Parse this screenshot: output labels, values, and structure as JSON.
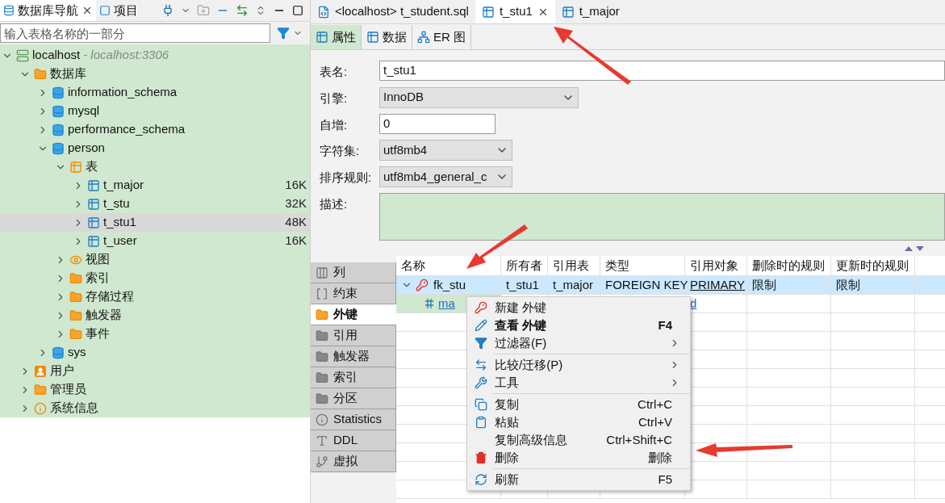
{
  "navigator": {
    "tabs": [
      {
        "label": "数据库导航",
        "selected": true,
        "closable": true,
        "kind": "db"
      },
      {
        "label": "项目",
        "selected": false,
        "closable": false,
        "kind": "project"
      }
    ],
    "filter": {
      "placeholder": "输入表格名称的一部分"
    },
    "tree": [
      {
        "label": "localhost",
        "suffix": " - localhost:3306",
        "kind": "server",
        "expanded": true,
        "selected": false,
        "children": [
          {
            "label": "数据库",
            "kind": "dbfolder",
            "expanded": true,
            "selected": false,
            "children": [
              {
                "label": "information_schema",
                "kind": "database",
                "expanded": false,
                "selected": false
              },
              {
                "label": "mysql",
                "kind": "database",
                "expanded": false,
                "selected": false
              },
              {
                "label": "performance_schema",
                "kind": "database",
                "expanded": false,
                "selected": false
              },
              {
                "label": "person",
                "kind": "database",
                "expanded": true,
                "selected": false,
                "children": [
                  {
                    "label": "表",
                    "kind": "tables",
                    "expanded": true,
                    "selected": false,
                    "children": [
                      {
                        "label": "t_major",
                        "kind": "table",
                        "expanded": false,
                        "selected": false,
                        "size": "16K"
                      },
                      {
                        "label": "t_stu",
                        "kind": "table",
                        "expanded": false,
                        "selected": false,
                        "size": "32K"
                      },
                      {
                        "label": "t_stu1",
                        "kind": "table",
                        "expanded": false,
                        "selected": true,
                        "size": "48K"
                      },
                      {
                        "label": "t_user",
                        "kind": "table",
                        "expanded": false,
                        "selected": false,
                        "size": "16K"
                      }
                    ]
                  },
                  {
                    "label": "视图",
                    "kind": "view",
                    "expanded": false,
                    "selected": false
                  },
                  {
                    "label": "索引",
                    "kind": "folder",
                    "expanded": false,
                    "selected": false
                  },
                  {
                    "label": "存储过程",
                    "kind": "folder",
                    "expanded": false,
                    "selected": false
                  },
                  {
                    "label": "触发器",
                    "kind": "folder",
                    "expanded": false,
                    "selected": false
                  },
                  {
                    "label": "事件",
                    "kind": "folder",
                    "expanded": false,
                    "selected": false
                  }
                ]
              },
              {
                "label": "sys",
                "kind": "database",
                "expanded": false,
                "selected": false
              }
            ]
          },
          {
            "label": "用户",
            "kind": "users",
            "expanded": false,
            "selected": false
          },
          {
            "label": "管理员",
            "kind": "admin",
            "expanded": false,
            "selected": false
          },
          {
            "label": "系统信息",
            "kind": "info",
            "expanded": false,
            "selected": false
          }
        ]
      }
    ]
  },
  "editor": {
    "tabs": [
      {
        "label": "<localhost> t_student.sql",
        "kind": "sql",
        "selected": false,
        "closable": false
      },
      {
        "label": "t_stu1",
        "kind": "table",
        "selected": true,
        "closable": true
      },
      {
        "label": "t_major",
        "kind": "table",
        "selected": false,
        "closable": false
      }
    ],
    "subtabs": [
      {
        "label": "属性",
        "kind": "table",
        "selected": true
      },
      {
        "label": "数据",
        "kind": "data",
        "selected": false
      },
      {
        "label": "ER 图",
        "kind": "er",
        "selected": false
      }
    ],
    "form": [
      {
        "label": "表名:",
        "kind": "text",
        "value": "t_stu1"
      },
      {
        "label": "引擎:",
        "kind": "select",
        "value": "InnoDB"
      },
      {
        "label": "自增:",
        "kind": "text",
        "value": "0"
      },
      {
        "label": "字符集:",
        "kind": "select",
        "value": "utf8mb4"
      },
      {
        "label": "排序规则:",
        "kind": "select",
        "value": "utf8mb4_general_c"
      },
      {
        "label": "描述:",
        "kind": "textarea"
      }
    ],
    "side_tabs": [
      {
        "label": "列",
        "kind": "columns",
        "selected": false
      },
      {
        "label": "约束",
        "kind": "constraint",
        "selected": false
      },
      {
        "label": "外键",
        "kind": "folder",
        "selected": true
      },
      {
        "label": "引用",
        "kind": "folder",
        "selected": false
      },
      {
        "label": "触发器",
        "kind": "folder",
        "selected": false
      },
      {
        "label": "索引",
        "kind": "folder",
        "selected": false
      },
      {
        "label": "分区",
        "kind": "folder",
        "selected": false
      },
      {
        "label": "Statistics",
        "kind": "info",
        "selected": false
      },
      {
        "label": "DDL",
        "kind": "ddl",
        "selected": false
      },
      {
        "label": "虚拟",
        "kind": "virtual",
        "selected": false
      }
    ],
    "table": {
      "columns": [
        "名称",
        "所有者",
        "引用表",
        "类型",
        "引用对象",
        "删除时的规则",
        "更新时的规则"
      ],
      "rows": [
        {
          "kind": "key",
          "selected": true,
          "expanded": true,
          "cells": [
            "fk_stu",
            "t_stu1",
            "t_major",
            "FOREIGN KEY",
            "PRIMARY",
            "限制",
            "限制"
          ]
        },
        {
          "kind": "column",
          "selected": false,
          "cells": [
            "ma",
            "",
            "",
            "",
            "d",
            "",
            ""
          ]
        }
      ]
    }
  },
  "context_menu": [
    [
      {
        "label": "新建 外键",
        "kind": "new_key",
        "bold": false,
        "submenu": false
      },
      {
        "label": "查看 外键",
        "kind": "edit",
        "shortcut": "F4",
        "bold": true,
        "submenu": false
      },
      {
        "label": "过滤器(F)",
        "kind": "filter",
        "bold": false,
        "submenu": true
      }
    ],
    [
      {
        "label": "比较/迁移(P)",
        "kind": "compare",
        "bold": false,
        "submenu": true
      },
      {
        "label": "工具",
        "kind": "tools",
        "bold": false,
        "submenu": true
      }
    ],
    [
      {
        "label": "复制",
        "kind": "copy",
        "shortcut": "Ctrl+C",
        "bold": false,
        "submenu": false
      },
      {
        "label": "粘贴",
        "kind": "paste",
        "shortcut": "Ctrl+V",
        "bold": false,
        "submenu": false
      },
      {
        "label": "复制高级信息",
        "kind": "plain",
        "shortcut": "Ctrl+Shift+C",
        "bold": false,
        "submenu": false
      },
      {
        "label": "删除",
        "kind": "delete",
        "shortcut": "删除",
        "bold": false,
        "submenu": false
      }
    ],
    [
      {
        "label": "刷新",
        "kind": "refresh",
        "shortcut": "F5",
        "bold": false,
        "submenu": false
      }
    ]
  ]
}
